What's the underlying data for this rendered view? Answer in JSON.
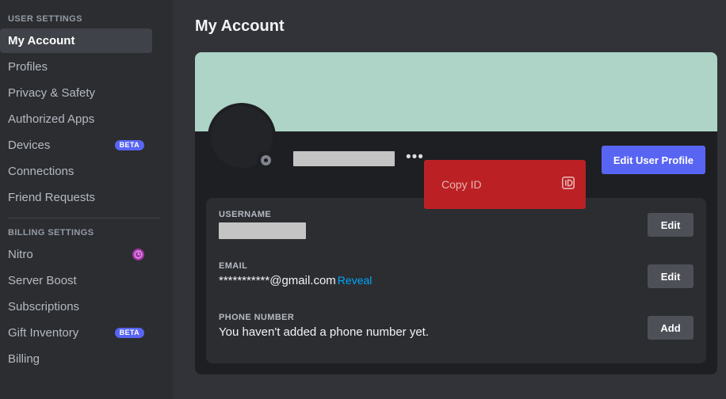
{
  "sidebar": {
    "sections": [
      {
        "header": "USER SETTINGS",
        "items": [
          {
            "label": "My Account",
            "selected": true,
            "badge": "",
            "icon": ""
          },
          {
            "label": "Profiles",
            "selected": false,
            "badge": "",
            "icon": ""
          },
          {
            "label": "Privacy & Safety",
            "selected": false,
            "badge": "",
            "icon": ""
          },
          {
            "label": "Authorized Apps",
            "selected": false,
            "badge": "",
            "icon": ""
          },
          {
            "label": "Devices",
            "selected": false,
            "badge": "BETA",
            "icon": ""
          },
          {
            "label": "Connections",
            "selected": false,
            "badge": "",
            "icon": ""
          },
          {
            "label": "Friend Requests",
            "selected": false,
            "badge": "",
            "icon": ""
          }
        ]
      },
      {
        "header": "BILLING SETTINGS",
        "items": [
          {
            "label": "Nitro",
            "selected": false,
            "badge": "",
            "icon": "nitro-icon"
          },
          {
            "label": "Server Boost",
            "selected": false,
            "badge": "",
            "icon": ""
          },
          {
            "label": "Subscriptions",
            "selected": false,
            "badge": "",
            "icon": ""
          },
          {
            "label": "Gift Inventory",
            "selected": false,
            "badge": "BETA",
            "icon": ""
          },
          {
            "label": "Billing",
            "selected": false,
            "badge": "",
            "icon": ""
          }
        ]
      }
    ]
  },
  "main": {
    "page_title": "My Account",
    "profile": {
      "banner_color": "#add4c6",
      "username_redacted": "",
      "more_options_glyph": "•••",
      "status": "offline",
      "edit_profile_label": "Edit User Profile"
    },
    "context_menu": {
      "copy_id_label": "Copy ID",
      "copy_id_icon": "id-card-icon",
      "background_color": "#bb2124"
    },
    "fields": [
      {
        "label": "USERNAME",
        "value": "",
        "redacted": true,
        "reveal_label": "",
        "button_label": "Edit"
      },
      {
        "label": "EMAIL",
        "value": "***********@gmail.com",
        "redacted": false,
        "reveal_label": "Reveal",
        "button_label": "Edit"
      },
      {
        "label": "PHONE NUMBER",
        "value": "You haven't added a phone number yet.",
        "redacted": false,
        "reveal_label": "",
        "button_label": "Add"
      }
    ]
  },
  "colors": {
    "accent_blurple": "#5865f2",
    "danger_red": "#bb2124",
    "link_blue": "#00a8fc",
    "sidebar_bg": "#2b2d31",
    "page_bg": "#313338",
    "card_bg": "#1e1f22"
  }
}
